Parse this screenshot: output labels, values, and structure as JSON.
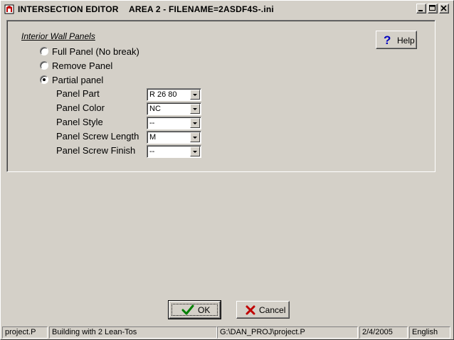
{
  "titlebar": {
    "app_title": "INTERSECTION EDITOR",
    "document_title": "AREA 2 - FILENAME=2ASDF4S-.ini",
    "app_icon": "app-logo-icon",
    "controls": [
      "minimize-icon",
      "maximize-icon",
      "close-icon"
    ]
  },
  "group": {
    "title": "Interior Wall Panels",
    "options": [
      {
        "label": "Full Panel (No break)",
        "selected": false
      },
      {
        "label": "Remove Panel",
        "selected": false
      },
      {
        "label": "Partial panel",
        "selected": true
      }
    ]
  },
  "fields": [
    {
      "label": "Panel Part",
      "value": "R 26 80"
    },
    {
      "label": "Panel Color",
      "value": "NC"
    },
    {
      "label": "Panel Style",
      "value": "--"
    },
    {
      "label": "Panel Screw Length",
      "value": "M"
    },
    {
      "label": "Panel Screw Finish",
      "value": "--"
    }
  ],
  "help_button": {
    "label": "Help",
    "icon": "question-mark-icon"
  },
  "buttons": {
    "ok_label": "OK",
    "ok_icon": "checkmark-icon",
    "cancel_label": "Cancel",
    "cancel_icon": "red-x-icon"
  },
  "statusbar": {
    "project": "project.P",
    "description": "Building with 2 Lean-Tos",
    "path": "G:\\DAN_PROJ\\project.P",
    "date": "2/4/2005",
    "language": "English"
  },
  "colors": {
    "face": "#d4d0c8",
    "help_icon": "#0000c0",
    "ok_check": "#008000",
    "cancel_x": "#c00000"
  }
}
